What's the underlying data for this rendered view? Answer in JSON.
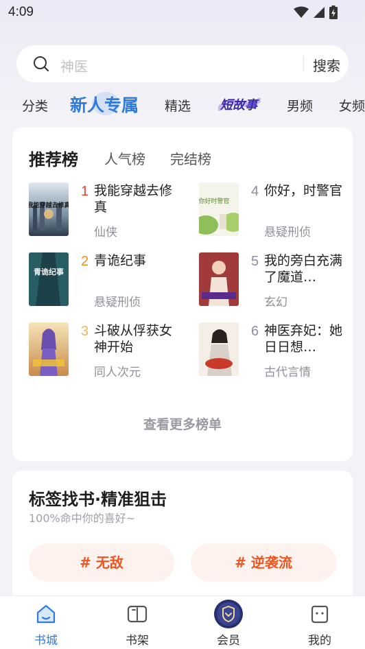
{
  "status": {
    "time": "4:09"
  },
  "search": {
    "placeholder": "神医",
    "button": "搜索"
  },
  "tabs": [
    "分类",
    "新人专属",
    "精选",
    "短故事",
    "男频",
    "女频"
  ],
  "ranking": {
    "tabs": [
      "推荐榜",
      "人气榜",
      "完结榜"
    ],
    "books": [
      {
        "rank": "1",
        "title": "我能穿越去修真",
        "genre": "仙侠",
        "cover_text": "我能穿越去修真"
      },
      {
        "rank": "2",
        "title": "青诡纪事",
        "genre": "悬疑刑侦",
        "cover_text": "青诡纪事"
      },
      {
        "rank": "3",
        "title": "斗破从俘获女神开始",
        "genre": "同人次元",
        "cover_text": ""
      },
      {
        "rank": "4",
        "title": "你好，时警官",
        "genre": "悬疑刑侦",
        "cover_text": "你好时警官"
      },
      {
        "rank": "5",
        "title": "我的旁白充满了魔道…",
        "genre": "玄幻",
        "cover_text": ""
      },
      {
        "rank": "6",
        "title": "神医弃妃：她日日想…",
        "genre": "古代言情",
        "cover_text": ""
      }
    ],
    "more": "查看更多榜单"
  },
  "tag_section": {
    "title": "标签找书·精准狙击",
    "subtitle": "100%命中你的喜好~",
    "tags": [
      "# 无敌",
      "# 逆袭流"
    ]
  },
  "nav": [
    {
      "label": "书城",
      "icon": "home-icon"
    },
    {
      "label": "书架",
      "icon": "book-icon"
    },
    {
      "label": "会员",
      "icon": "vip-shield-icon"
    },
    {
      "label": "我的",
      "icon": "profile-icon"
    }
  ],
  "colors": {
    "accent": "#2f7bd9",
    "rank_red": "#f0412e",
    "rank_orange": "#f58a1f",
    "rank_gold": "#f0b25a",
    "rank_gray": "#8c8da6",
    "tag_text": "#f0541f"
  }
}
